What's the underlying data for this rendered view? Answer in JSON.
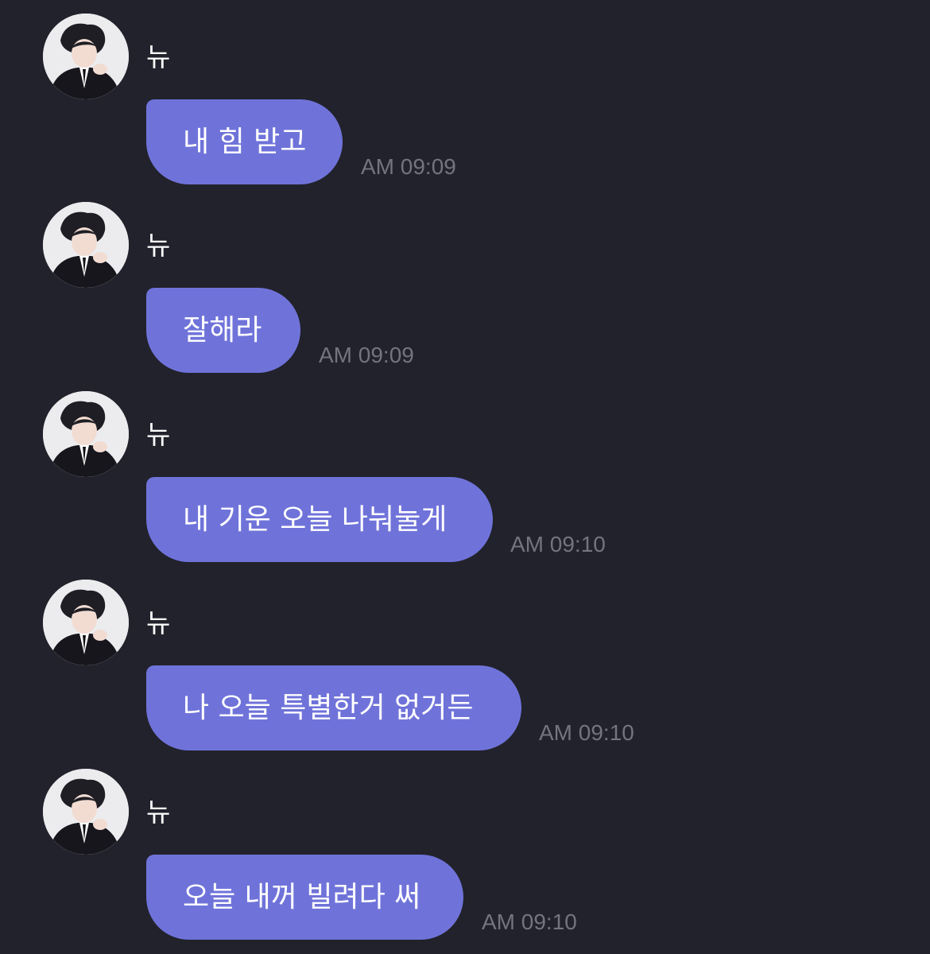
{
  "messages": [
    {
      "sender": "뉴",
      "text": "내 힘 받고",
      "time": "AM 09:09"
    },
    {
      "sender": "뉴",
      "text": "잘해라",
      "time": "AM 09:09"
    },
    {
      "sender": "뉴",
      "text": "내 기운 오늘 나눠눌게",
      "time": "AM 09:10"
    },
    {
      "sender": "뉴",
      "text": "나 오늘 특별한거 없거든",
      "time": "AM 09:10"
    },
    {
      "sender": "뉴",
      "text": "오늘 내꺼 빌려다 써",
      "time": "AM 09:10"
    }
  ],
  "colors": {
    "background": "#22222c",
    "bubble": "#6f73d9",
    "time_text": "#74747e",
    "sender_text": "#ffffff"
  },
  "icons": {
    "avatar": "profile-photo-avatar"
  }
}
